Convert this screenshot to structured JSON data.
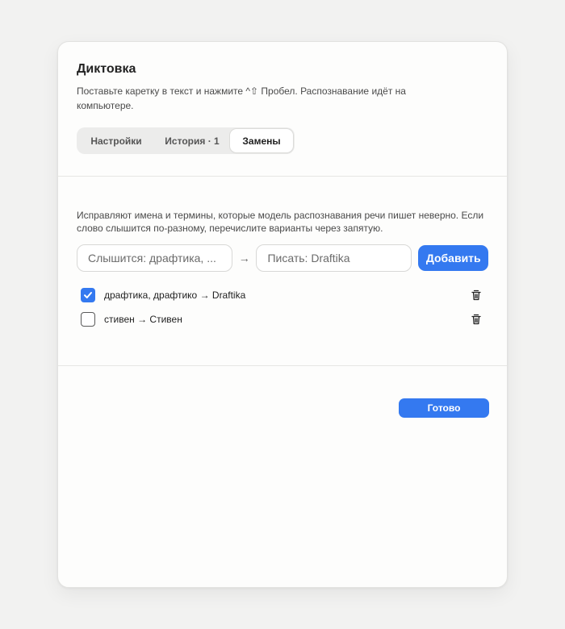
{
  "dialog": {
    "title": "Диктовка",
    "subtitle": "Поставьте каретку в текст и нажмите ^⇧ Пробел. Распознавание идёт на компьютере."
  },
  "tabs": [
    {
      "label": "Настройки",
      "active": false
    },
    {
      "label": "История · 1",
      "active": false
    },
    {
      "label": "Замены",
      "active": true
    }
  ],
  "replacements": {
    "description": "Исправляют имена и термины, которые модель распознавания речи пишет неверно. Если слово слышится по-разному, перечислите варианты через запятую.",
    "heard_placeholder": "Слышится: драфтика, ...",
    "write_placeholder": "Писать: Draftika",
    "arrow": "→",
    "add_label": "Добавить",
    "items": [
      {
        "text": "драфтика, драфтико → Draftika",
        "checked": true,
        "icon": "trash-icon"
      },
      {
        "text": "стивен → Стивен",
        "checked": false,
        "icon": "trash-icon"
      }
    ]
  },
  "footer": {
    "done_label": "Готово"
  },
  "colors": {
    "accent": "#3479f0",
    "background": "#f2f2f1",
    "panel": "#fdfdfc"
  }
}
